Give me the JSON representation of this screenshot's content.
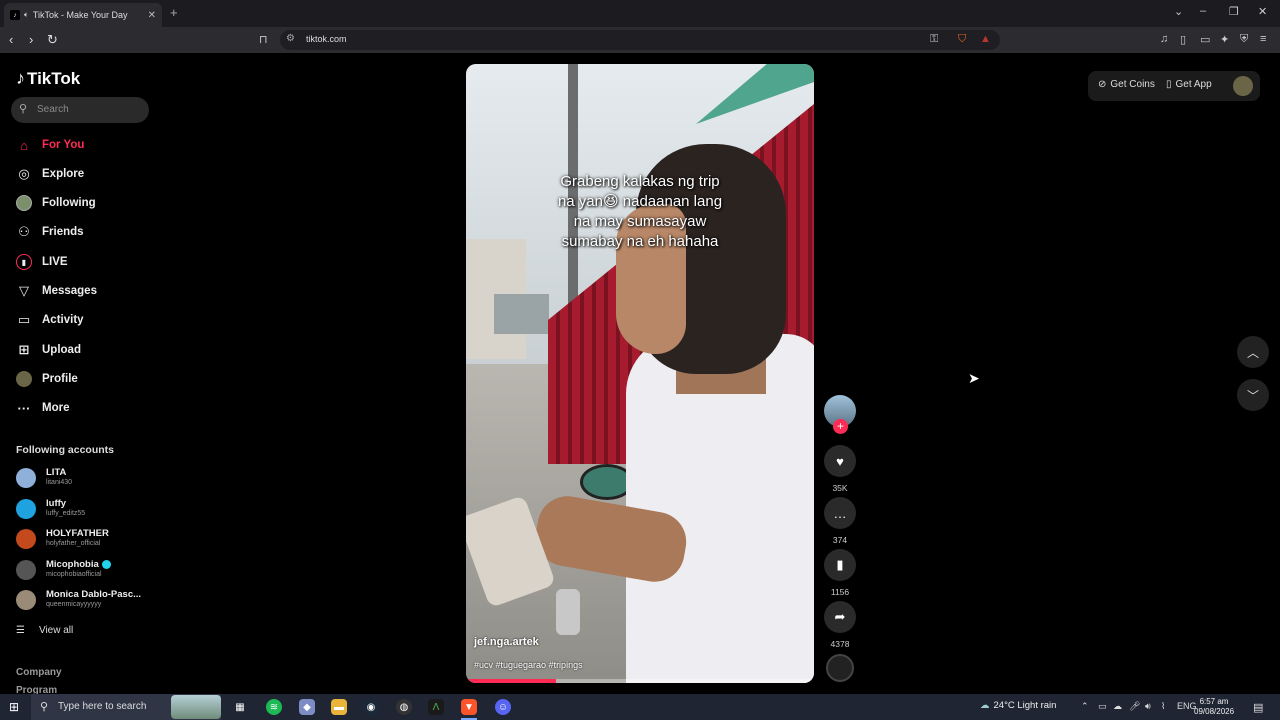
{
  "browser": {
    "tab_title": "TikTok - Make Your Day",
    "url": "tiktok.com",
    "new_tab_label": "+"
  },
  "sidebar": {
    "logo": "TikTok",
    "search_placeholder": "Search",
    "nav": [
      {
        "label": "For You",
        "icon": "home-icon",
        "active": true
      },
      {
        "label": "Explore",
        "icon": "compass-icon"
      },
      {
        "label": "Following",
        "icon": "following-avatar-icon"
      },
      {
        "label": "Friends",
        "icon": "friends-icon"
      },
      {
        "label": "LIVE",
        "icon": "live-icon"
      },
      {
        "label": "Messages",
        "icon": "messages-icon"
      },
      {
        "label": "Activity",
        "icon": "activity-icon"
      },
      {
        "label": "Upload",
        "icon": "upload-icon"
      },
      {
        "label": "Profile",
        "icon": "profile-avatar-icon"
      },
      {
        "label": "More",
        "icon": "more-icon"
      }
    ],
    "following_heading": "Following accounts",
    "accounts": [
      {
        "name": "LITA",
        "handle": "litani430",
        "color": "#8fb0d8"
      },
      {
        "name": "luffy",
        "handle": "luffy_editz55",
        "color": "#1fa3e0"
      },
      {
        "name": "HOLYFATHER",
        "handle": "holyfather_official",
        "color": "#c24a1c"
      },
      {
        "name": "Micophobia",
        "handle": "micophobiaofficial",
        "color": "#555555",
        "verified": true
      },
      {
        "name": "Monica Dablo-Pasc...",
        "handle": "queenmicayyyyyy",
        "color": "#9a8a78"
      }
    ],
    "view_all": "View all",
    "footer": [
      "Company",
      "Program"
    ]
  },
  "video": {
    "caption_lines": [
      "Grabeng kalakas ng trip",
      "na yan😆 nadaanan lang",
      "na may sumasayaw",
      "sumabay na eh hahaha"
    ],
    "author": "jef.nga.artek",
    "tags": "#ucv #tuguegarao #tripings",
    "progress": 0.26
  },
  "actions": {
    "likes": "35K",
    "comments": "374",
    "saves": "1156",
    "shares": "4378"
  },
  "topbar": {
    "get_coins": "Get Coins",
    "get_app": "Get App"
  },
  "taskbar": {
    "search_placeholder": "Type here to search",
    "weather": "24°C  Light rain",
    "language": "ENG",
    "time": "6:57 am",
    "date": "09/08/2026"
  }
}
